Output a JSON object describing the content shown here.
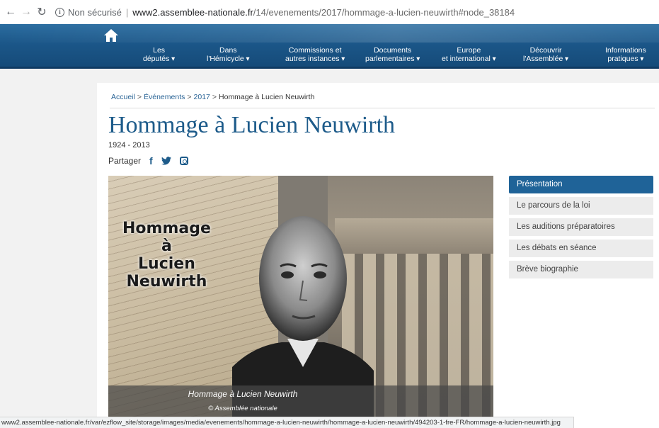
{
  "browser": {
    "security_label": "Non sécurisé",
    "url_domain": "www2.assemblee-nationale.fr",
    "url_path": "/14/evenements/2017/hommage-a-lucien-neuwirth#node_38184"
  },
  "nav": {
    "items": [
      {
        "line1": "Les",
        "line2": "députés"
      },
      {
        "line1": "Dans",
        "line2": "l'Hémicycle"
      },
      {
        "line1": "Commissions et",
        "line2": "autres instances"
      },
      {
        "line1": "Documents",
        "line2": "parlementaires"
      },
      {
        "line1": "Europe",
        "line2": "et international"
      },
      {
        "line1": "Découvrir",
        "line2": "l'Assemblée"
      },
      {
        "line1": "Informations",
        "line2": "pratiques"
      }
    ]
  },
  "breadcrumb": {
    "items": [
      "Accueil",
      "Événements",
      "2017"
    ],
    "current": "Hommage à Lucien Neuwirth",
    "separator": ">"
  },
  "page": {
    "title": "Hommage à Lucien Neuwirth",
    "years": "1924 - 2013",
    "share_label": "Partager"
  },
  "hero": {
    "overlay_lines": [
      "Hommage",
      "à",
      "Lucien",
      "Neuwirth"
    ],
    "caption": "Hommage à Lucien Neuwirth",
    "credit": "© Assemblée nationale"
  },
  "sidemenu": {
    "items": [
      {
        "label": "Présentation",
        "active": true
      },
      {
        "label": "Le parcours de la loi"
      },
      {
        "label": "Les auditions préparatoires"
      },
      {
        "label": "Les débats en séance"
      },
      {
        "label": "Brève biographie"
      }
    ]
  },
  "statusbar": {
    "text": "www2.assemblee-nationale.fr/var/ezflow_site/storage/images/media/evenements/hommage-a-lucien-neuwirth/hommage-a-lucien-neuwirth/494203-1-fre-FR/hommage-a-lucien-neuwirth.jpg"
  },
  "colors": {
    "nav_blue": "#1b5688",
    "title_blue": "#1d5b8a",
    "active_menu": "#1f6398"
  }
}
